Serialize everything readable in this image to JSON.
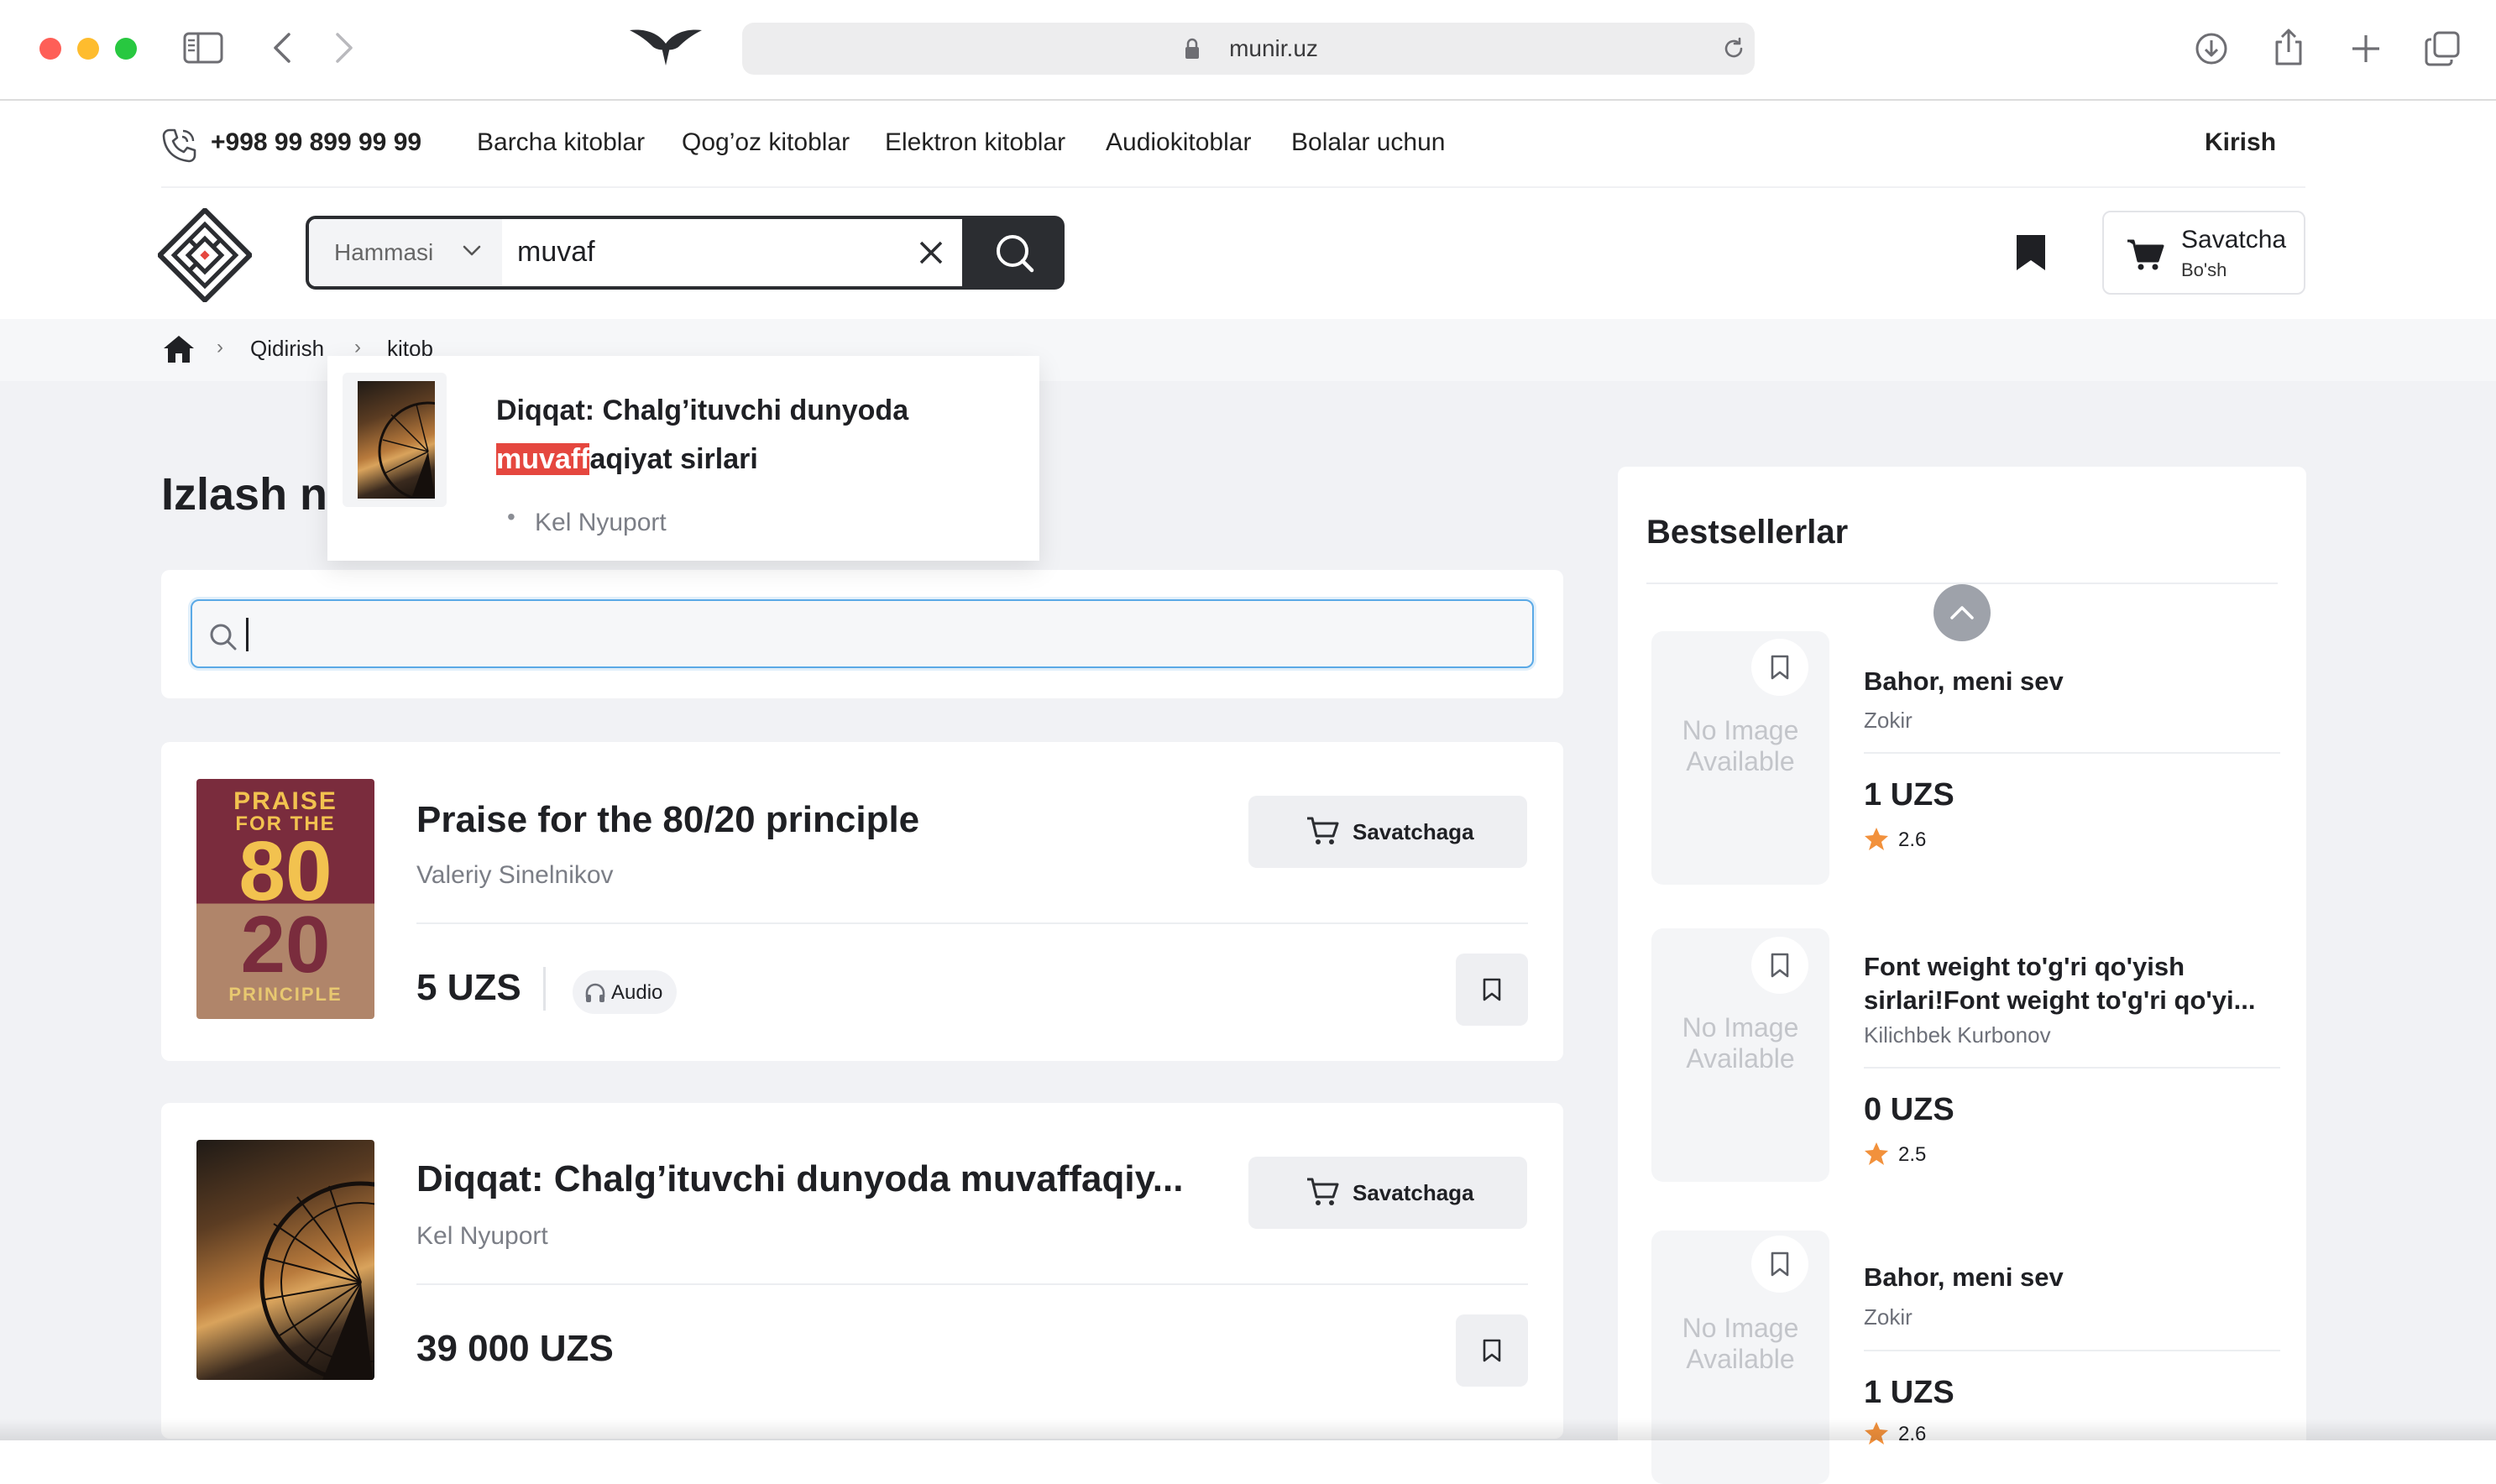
{
  "browser": {
    "url": "munir.uz",
    "icons": [
      "sidebar-icon",
      "back-icon",
      "forward-icon",
      "site-logo-wings-icon",
      "lock-icon",
      "reload-icon",
      "download-icon",
      "share-icon",
      "new-tab-icon",
      "tabs-overview-icon"
    ]
  },
  "topnav": {
    "phone": "+998 99 899 99 99",
    "links": [
      "Barcha kitoblar",
      "Qog’oz kitoblar",
      "Elektron kitoblar",
      "Audiokitoblar",
      "Bolalar uchun"
    ],
    "login": "Kirish"
  },
  "header": {
    "search": {
      "category": "Hammasi",
      "query": "muvaf"
    },
    "cart": {
      "label": "Savatcha",
      "status": "Bo'sh"
    }
  },
  "breadcrumb": [
    "Qidirish",
    "kitob"
  ],
  "suggestion": {
    "title_line1": "Diqqat: Chalg’ituvchi dunyoda",
    "title_highlight": "muvaff",
    "title_rest": "aqiyat sirlari",
    "author": "Kel Nyuport"
  },
  "page": {
    "heading_visible": "Izlash n",
    "search_placeholder": ""
  },
  "results": [
    {
      "title": "Praise for the 80/20 principle",
      "author": "Valeriy Sinelnikov",
      "price": "5 UZS",
      "badge": "Audio",
      "cart_button": "Savatchaga",
      "cover": {
        "line1": "PRAISE",
        "line2": "FOR THE",
        "num1": "80",
        "num2": "20",
        "line3": "PRINCIPLE"
      }
    },
    {
      "title": "Diqqat: Chalg’ituvchi dunyoda muvaffaqiy...",
      "author": "Kel Nyuport",
      "price": "39 000 UZS",
      "cart_button": "Savatchaga"
    }
  ],
  "bestsellers": {
    "title": "Bestsellerlar",
    "no_image": "No Image Available",
    "items": [
      {
        "title": "Bahor, meni sev",
        "author": "Zokir",
        "price": "1 UZS",
        "rating": "2.6"
      },
      {
        "title": "Font weight to'g'ri qo'yish sirlari!Font weight to'g'ri qo'yi...",
        "author": "Kilichbek Kurbonov",
        "price": "0 UZS",
        "rating": "2.5"
      },
      {
        "title": "Bahor, meni sev",
        "author": "Zokir",
        "price": "1 UZS",
        "rating": "2.6"
      }
    ]
  },
  "colors": {
    "accent_dark": "#2b2d31",
    "highlight_red": "#e5473f",
    "star": "#f2913c",
    "page_bg": "#f1f2f5"
  }
}
